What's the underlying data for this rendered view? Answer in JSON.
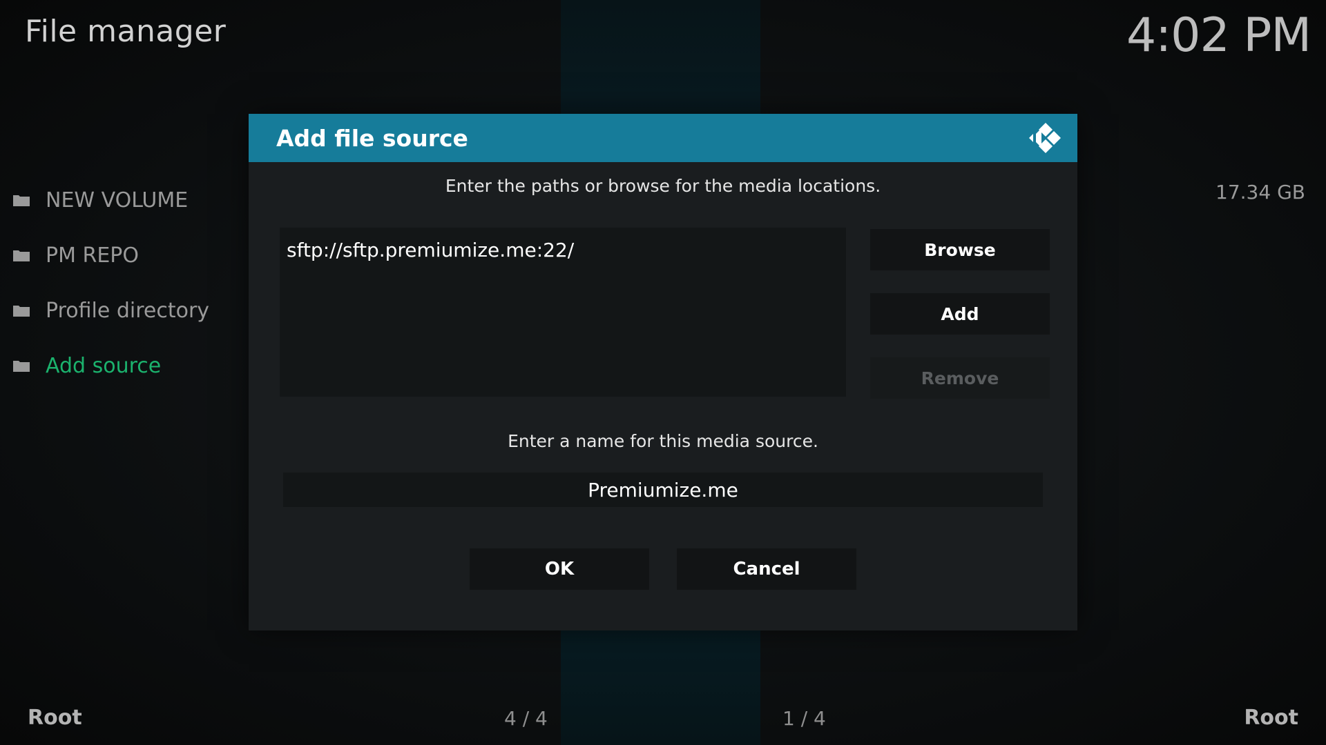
{
  "header": {
    "page_title": "File manager",
    "clock": "4:02 PM"
  },
  "left_list": {
    "items": [
      {
        "label": "NEW VOLUME",
        "icon": "folder-icon"
      },
      {
        "label": "PM REPO",
        "icon": "folder-icon"
      },
      {
        "label": "Profile directory",
        "icon": "folder-icon"
      },
      {
        "label": "Add source",
        "icon": "folder-icon",
        "active": true
      }
    ]
  },
  "right_panel": {
    "size": "17.34 GB"
  },
  "footer": {
    "left_label": "Root",
    "right_label": "Root",
    "left_count": "4 / 4",
    "right_count": "1 / 4"
  },
  "dialog": {
    "title": "Add file source",
    "logo_icon": "kodi-logo-icon",
    "paths_instruction": "Enter the paths or browse for the media locations.",
    "paths": [
      "sftp://sftp.premiumize.me:22/"
    ],
    "browse_label": "Browse",
    "add_label": "Add",
    "remove_label": "Remove",
    "name_instruction": "Enter a name for this media source.",
    "name_value": "Premiumize.me",
    "ok_label": "OK",
    "cancel_label": "Cancel"
  },
  "colors": {
    "header_bar": "#167c9a",
    "active_item": "#1bb26d",
    "dialog_bg": "#1a1d1f",
    "disabled_text": "#5a5d5f"
  }
}
